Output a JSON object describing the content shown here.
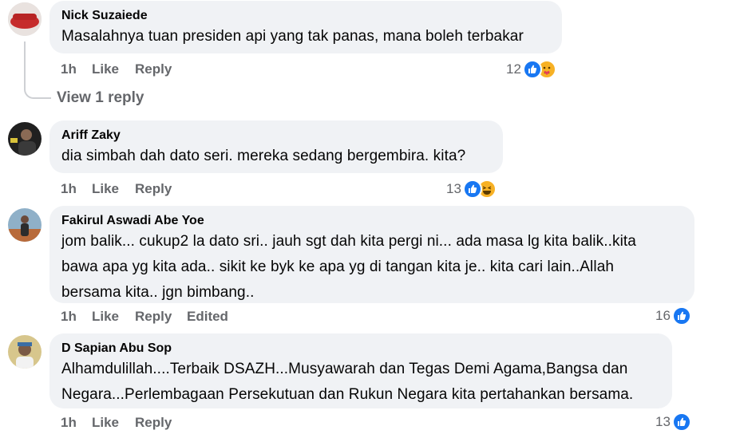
{
  "colors": {
    "like_blue": "#1877f2",
    "bubble_bg": "#f0f2f5",
    "meta_gray": "#65676b"
  },
  "comments": [
    {
      "author": "Nick Suzaiede",
      "lines": [
        "Masalahnya tuan presiden api yang tak panas, mana boleh terbakar"
      ],
      "time": "1h",
      "like": "Like",
      "reply": "Reply",
      "reaction_count": "12",
      "reactions": [
        "like-icon",
        "care-icon"
      ],
      "view_replies": "View 1 reply"
    },
    {
      "author": "Ariff Zaky",
      "lines": [
        "dia simbah dah dato seri. mereka sedang bergembira. kita?"
      ],
      "time": "1h",
      "like": "Like",
      "reply": "Reply",
      "reaction_count": "13",
      "reactions": [
        "like-icon",
        "haha-icon"
      ]
    },
    {
      "author": "Fakirul Aswadi Abe Yoe",
      "lines": [
        "jom balik... cukup2 la dato sri.. jauh sgt dah kita pergi ni... ada masa lg kita balik..kita",
        "bawa apa yg kita ada.. sikit ke byk ke apa yg di tangan kita je.. kita cari lain..Allah",
        "bersama kita.. jgn bimbang.."
      ],
      "time": "1h",
      "like": "Like",
      "reply": "Reply",
      "edited": "Edited",
      "reaction_count": "16",
      "reactions": [
        "like-icon"
      ]
    },
    {
      "author": "D Sapian Abu Sop",
      "lines": [
        "Alhamdulillah....Terbaik DSAZH...Musyawarah dan Tegas Demi Agama,Bangsa dan",
        "Negara...Perlembagaan Persekutuan dan Rukun Negara kita pertahankan bersama."
      ],
      "time": "1h",
      "like": "Like",
      "reply": "Reply",
      "reaction_count": "13",
      "reactions": [
        "like-icon"
      ]
    }
  ]
}
